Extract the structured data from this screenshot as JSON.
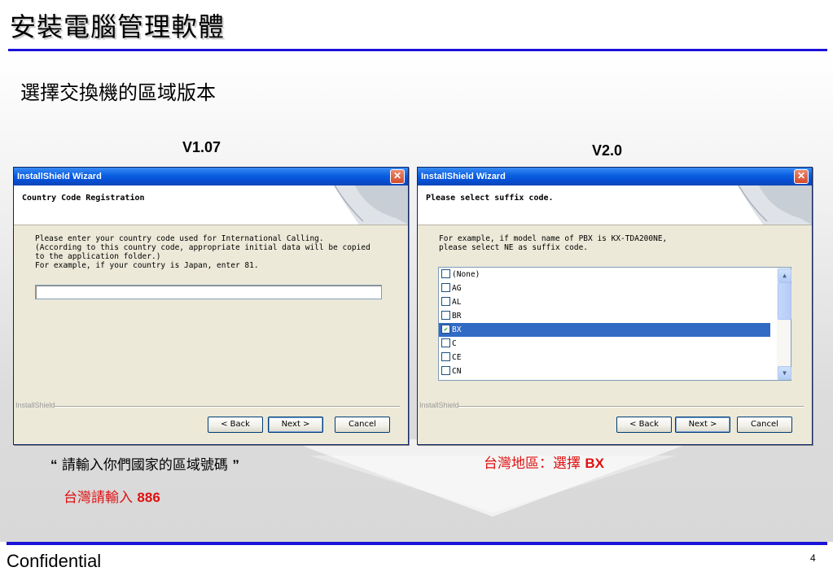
{
  "slide": {
    "title": "安裝電腦管理軟體",
    "subtitle": "選擇交換機的區域版本",
    "footer": "Confidential",
    "page_number": "4"
  },
  "left": {
    "version_label": "V1.07",
    "dialog": {
      "window_title": "InstallShield Wizard",
      "header_title": "Country Code Registration",
      "body_lines": [
        "Please enter your country code used for International Calling.",
        "(According to this country code, appropriate initial data will be copied",
        "to the application folder.)",
        "For example, if your country is Japan, enter 81."
      ],
      "input_value": "",
      "brand_label": "InstallShield",
      "back_button": "< Back",
      "next_button": "Next >",
      "cancel_button": "Cancel"
    },
    "caption_open_quote": "“",
    "caption": "請輸入你們國家的區域號碼",
    "caption_close_quote": "”",
    "note_prefix": "台灣請輸入",
    "note_value": "886"
  },
  "right": {
    "version_label": "V2.0",
    "dialog": {
      "window_title": "InstallShield Wizard",
      "header_title": "Please select suffix code.",
      "body_lines": [
        "For example, if model name of PBX is KX-TDA200NE,",
        "please select NE as suffix code."
      ],
      "list_items": [
        {
          "label": "(None)",
          "checked": false
        },
        {
          "label": "AG",
          "checked": false
        },
        {
          "label": "AL",
          "checked": false
        },
        {
          "label": "BR",
          "checked": false
        },
        {
          "label": "BX",
          "checked": true
        },
        {
          "label": "C",
          "checked": false
        },
        {
          "label": "CE",
          "checked": false
        },
        {
          "label": "CN",
          "checked": false
        }
      ],
      "selected_index": 4,
      "brand_label": "InstallShield",
      "back_button": "< Back",
      "next_button": "Next >",
      "cancel_button": "Cancel"
    },
    "note_prefix": "台灣地區：選擇",
    "note_value": "BX"
  },
  "colors": {
    "accent_rule": "#1b12d8",
    "note_red": "#e01010",
    "selection": "#316ac5"
  }
}
